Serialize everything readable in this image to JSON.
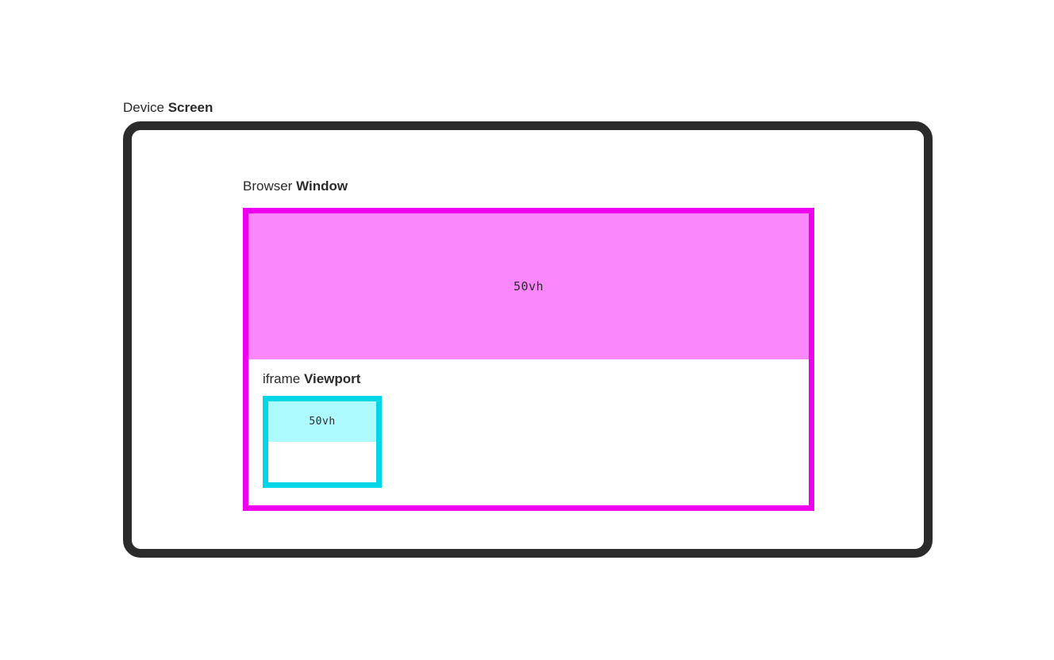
{
  "device": {
    "label_prefix": "Device ",
    "label_bold": "Screen",
    "border_color": "#2b2b2b"
  },
  "browser": {
    "label_prefix": "Browser ",
    "label_bold": "Window",
    "border_color": "#ee00ee",
    "fill_color": "#fb87fd",
    "fill_text": "50vh"
  },
  "iframe": {
    "label_prefix": "iframe ",
    "label_bold": "Viewport",
    "border_color": "#00d6e6",
    "fill_color": "#aefbff",
    "fill_text": "50vh"
  }
}
